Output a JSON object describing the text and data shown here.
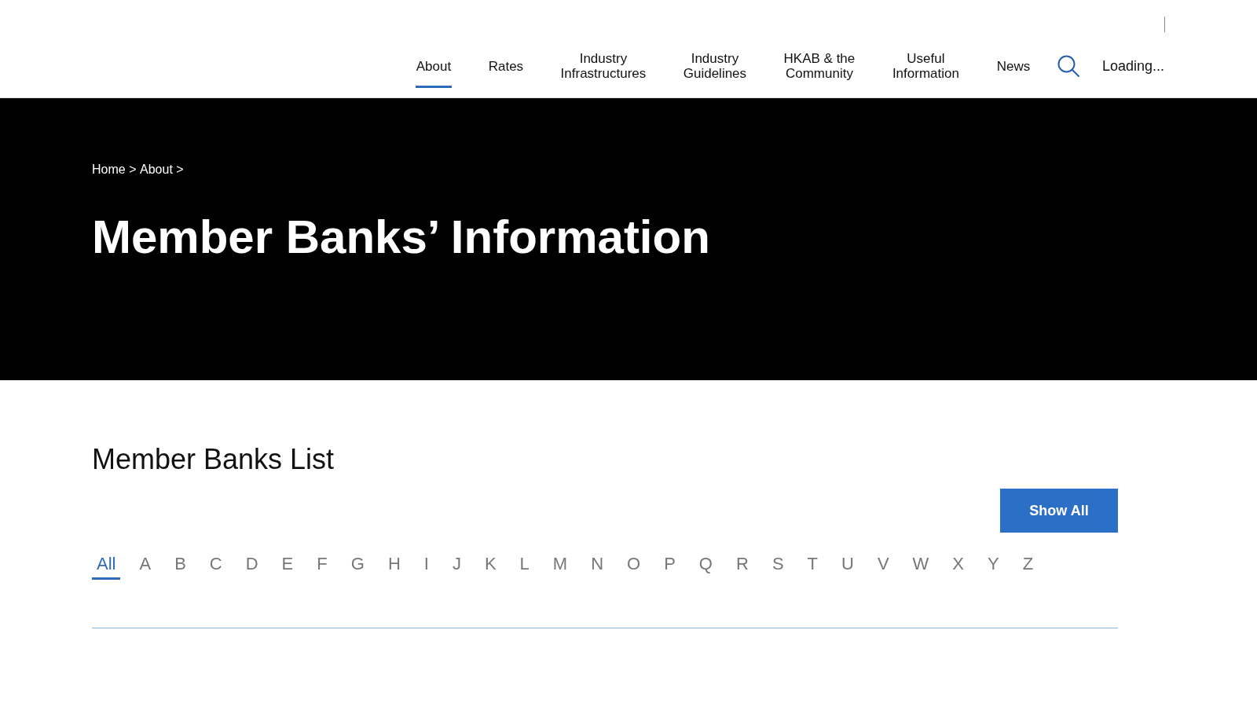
{
  "header": {
    "nav": [
      {
        "label": "About",
        "selected": true
      },
      {
        "label": "Rates",
        "selected": false
      },
      {
        "label": "Industry Infrastructures",
        "selected": false
      },
      {
        "label": "Industry Guidelines",
        "selected": false
      },
      {
        "label": "HKAB & the Community",
        "selected": false
      },
      {
        "label": "Useful Information",
        "selected": false
      },
      {
        "label": "News",
        "selected": false
      }
    ],
    "status_text": "Loading..."
  },
  "hero": {
    "breadcrumb": [
      {
        "label": "Home",
        "separator": ">"
      },
      {
        "label": "About",
        "separator": ">"
      }
    ],
    "title": "Member Banks’ Information"
  },
  "member_banks": {
    "heading": "Member Banks List",
    "show_all_button": "Show All",
    "letter_filter": [
      {
        "label": "All",
        "selected": true
      },
      {
        "label": "A",
        "selected": false
      },
      {
        "label": "B",
        "selected": false
      },
      {
        "label": "C",
        "selected": false
      },
      {
        "label": "D",
        "selected": false
      },
      {
        "label": "E",
        "selected": false
      },
      {
        "label": "F",
        "selected": false
      },
      {
        "label": "G",
        "selected": false
      },
      {
        "label": "H",
        "selected": false
      },
      {
        "label": "I",
        "selected": false
      },
      {
        "label": "J",
        "selected": false
      },
      {
        "label": "K",
        "selected": false
      },
      {
        "label": "L",
        "selected": false
      },
      {
        "label": "M",
        "selected": false
      },
      {
        "label": "N",
        "selected": false
      },
      {
        "label": "O",
        "selected": false
      },
      {
        "label": "P",
        "selected": false
      },
      {
        "label": "Q",
        "selected": false
      },
      {
        "label": "R",
        "selected": false
      },
      {
        "label": "S",
        "selected": false
      },
      {
        "label": "T",
        "selected": false
      },
      {
        "label": "U",
        "selected": false
      },
      {
        "label": "V",
        "selected": false
      },
      {
        "label": "W",
        "selected": false
      },
      {
        "label": "X",
        "selected": false
      },
      {
        "label": "Y",
        "selected": false
      },
      {
        "label": "Z",
        "selected": false
      }
    ]
  }
}
